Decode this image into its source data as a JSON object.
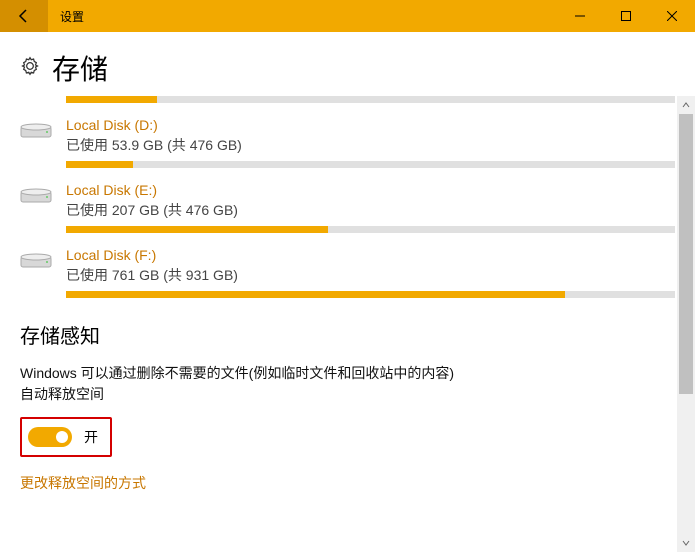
{
  "window": {
    "title": "设置"
  },
  "header": {
    "title": "存储"
  },
  "disks": [
    {
      "name": "Local Disk (D:)",
      "usage_text": "已使用 53.9 GB (共 476 GB)",
      "used_gb": 53.9,
      "total_gb": 476,
      "fill_pct": 11
    },
    {
      "name": "Local Disk (E:)",
      "usage_text": "已使用 207 GB (共 476 GB)",
      "used_gb": 207,
      "total_gb": 476,
      "fill_pct": 43
    },
    {
      "name": "Local Disk (F:)",
      "usage_text": "已使用 761 GB (共 931 GB)",
      "used_gb": 761,
      "total_gb": 931,
      "fill_pct": 82
    }
  ],
  "top_partial_fill_pct": 15,
  "storage_sense": {
    "section_title": "存储感知",
    "description": "Windows 可以通过删除不需要的文件(例如临时文件和回收站中的内容)自动释放空间",
    "toggle_label": "开",
    "toggle_on": true,
    "link_text": "更改释放空间的方式"
  },
  "colors": {
    "accent": "#f2a900",
    "link": "#c87700",
    "highlight_border": "#d40000"
  }
}
